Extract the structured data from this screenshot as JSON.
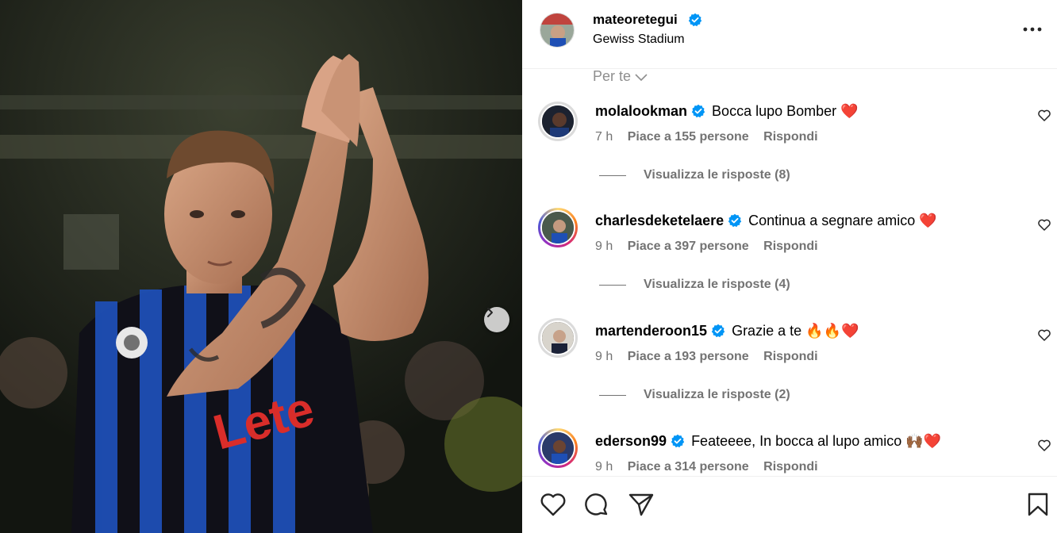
{
  "post": {
    "username": "mateoretegui",
    "location": "Gewiss Stadium"
  },
  "sort": {
    "label": "Per te"
  },
  "comments": [
    {
      "username": "molalookman",
      "text": "Bocca lupo Bomber",
      "emoji": "❤️",
      "time": "7 h",
      "likes": "Piace a 155 persone",
      "reply": "Rispondi",
      "replies": "Visualizza le risposte (8)",
      "ring": "plain"
    },
    {
      "username": "charlesdeketelaere",
      "text": "Continua a segnare amico",
      "emoji": "❤️",
      "time": "9 h",
      "likes": "Piace a 397 persone",
      "reply": "Rispondi",
      "replies": "Visualizza le risposte (4)",
      "ring": "story"
    },
    {
      "username": "martenderoon15",
      "text": "Grazie a te",
      "emoji": "🔥🔥❤️",
      "time": "9 h",
      "likes": "Piace a 193 persone",
      "reply": "Rispondi",
      "replies": "Visualizza le risposte (2)",
      "ring": "plain"
    },
    {
      "username": "ederson99",
      "text": "Feateeee, In bocca al lupo amico",
      "emoji": "🙌🏾❤️",
      "time": "9 h",
      "likes": "Piace a 314 persone",
      "reply": "Rispondi",
      "replies": "",
      "ring": "story"
    }
  ],
  "icons": {
    "verified": "verified-badge-icon",
    "heart": "heart-icon",
    "comment": "comment-icon",
    "share": "share-icon",
    "save": "bookmark-icon",
    "more": "more-options-icon",
    "next": "chevron-right-icon"
  },
  "colors": {
    "verified_blue": "#0095f6",
    "meta_gray": "#737373",
    "emoji_red": "#e0245e"
  }
}
